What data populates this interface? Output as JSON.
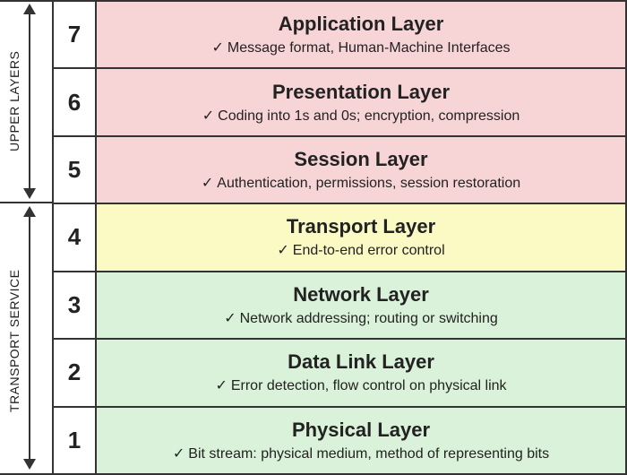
{
  "groups": {
    "upper_label": "UPPER LAYERS",
    "lower_label": "TRANSPORT SERVICE"
  },
  "layers": [
    {
      "num": "7",
      "title": "Application Layer",
      "desc": "Message format, Human-Machine Interfaces",
      "color": "pink"
    },
    {
      "num": "6",
      "title": "Presentation Layer",
      "desc": "Coding into 1s and 0s; encryption, compression",
      "color": "pink"
    },
    {
      "num": "5",
      "title": "Session Layer",
      "desc": "Authentication, permissions, session restoration",
      "color": "pink"
    },
    {
      "num": "4",
      "title": "Transport Layer",
      "desc": "End-to-end error control",
      "color": "yellow"
    },
    {
      "num": "3",
      "title": "Network Layer",
      "desc": "Network addressing; routing or switching",
      "color": "green"
    },
    {
      "num": "2",
      "title": "Data Link Layer",
      "desc": "Error detection, flow control on physical link",
      "color": "green"
    },
    {
      "num": "1",
      "title": "Physical Layer",
      "desc": "Bit stream: physical medium, method of representing bits",
      "color": "green"
    }
  ],
  "checkmark": "✓"
}
